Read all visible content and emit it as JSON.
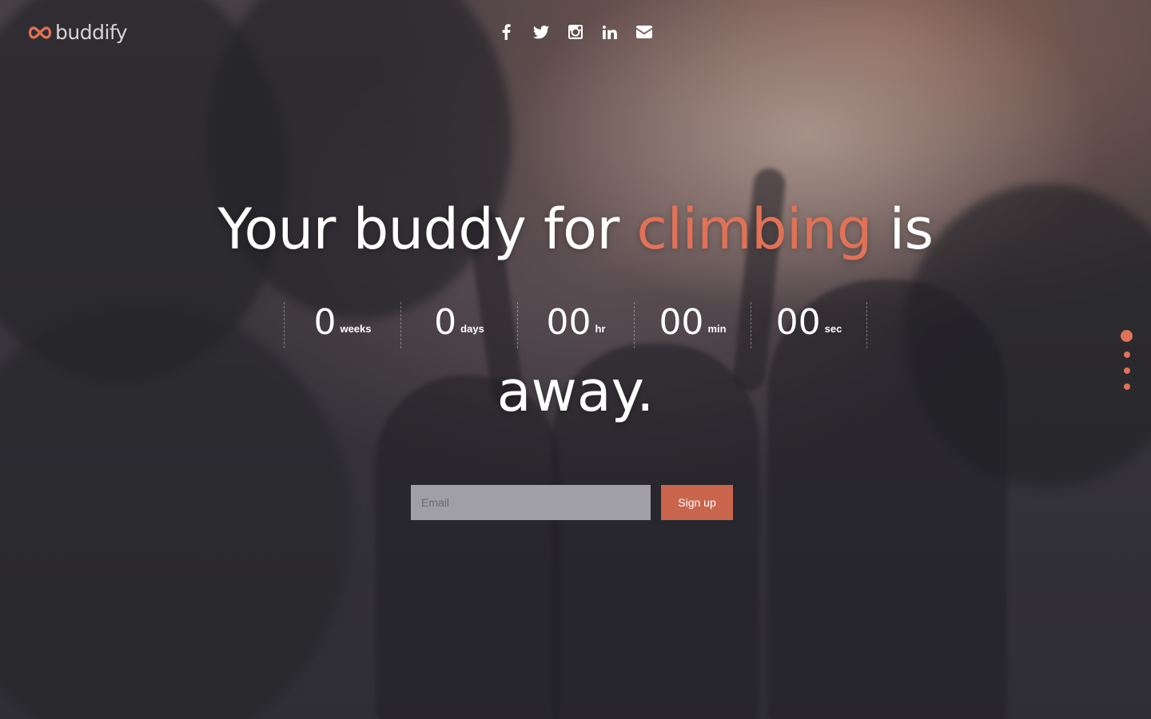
{
  "brand": {
    "name": "buddify",
    "accent_color": "#e07257"
  },
  "social": [
    {
      "icon": "facebook-icon"
    },
    {
      "icon": "twitter-icon"
    },
    {
      "icon": "instagram-icon"
    },
    {
      "icon": "linkedin-icon"
    },
    {
      "icon": "envelope-icon"
    }
  ],
  "hero": {
    "headline_before": "Your buddy for ",
    "headline_accent": "climbing",
    "headline_after": " is",
    "headline_tail": "away."
  },
  "countdown": [
    {
      "value": "0",
      "unit": "weeks"
    },
    {
      "value": "0",
      "unit": "days"
    },
    {
      "value": "00",
      "unit": "hr"
    },
    {
      "value": "00",
      "unit": "min"
    },
    {
      "value": "00",
      "unit": "sec"
    }
  ],
  "signup": {
    "email_placeholder": "Email",
    "email_value": "",
    "button_label": "Sign up",
    "button_color": "#c9654c"
  },
  "dot_nav": {
    "count": 4,
    "active_index": 0
  }
}
